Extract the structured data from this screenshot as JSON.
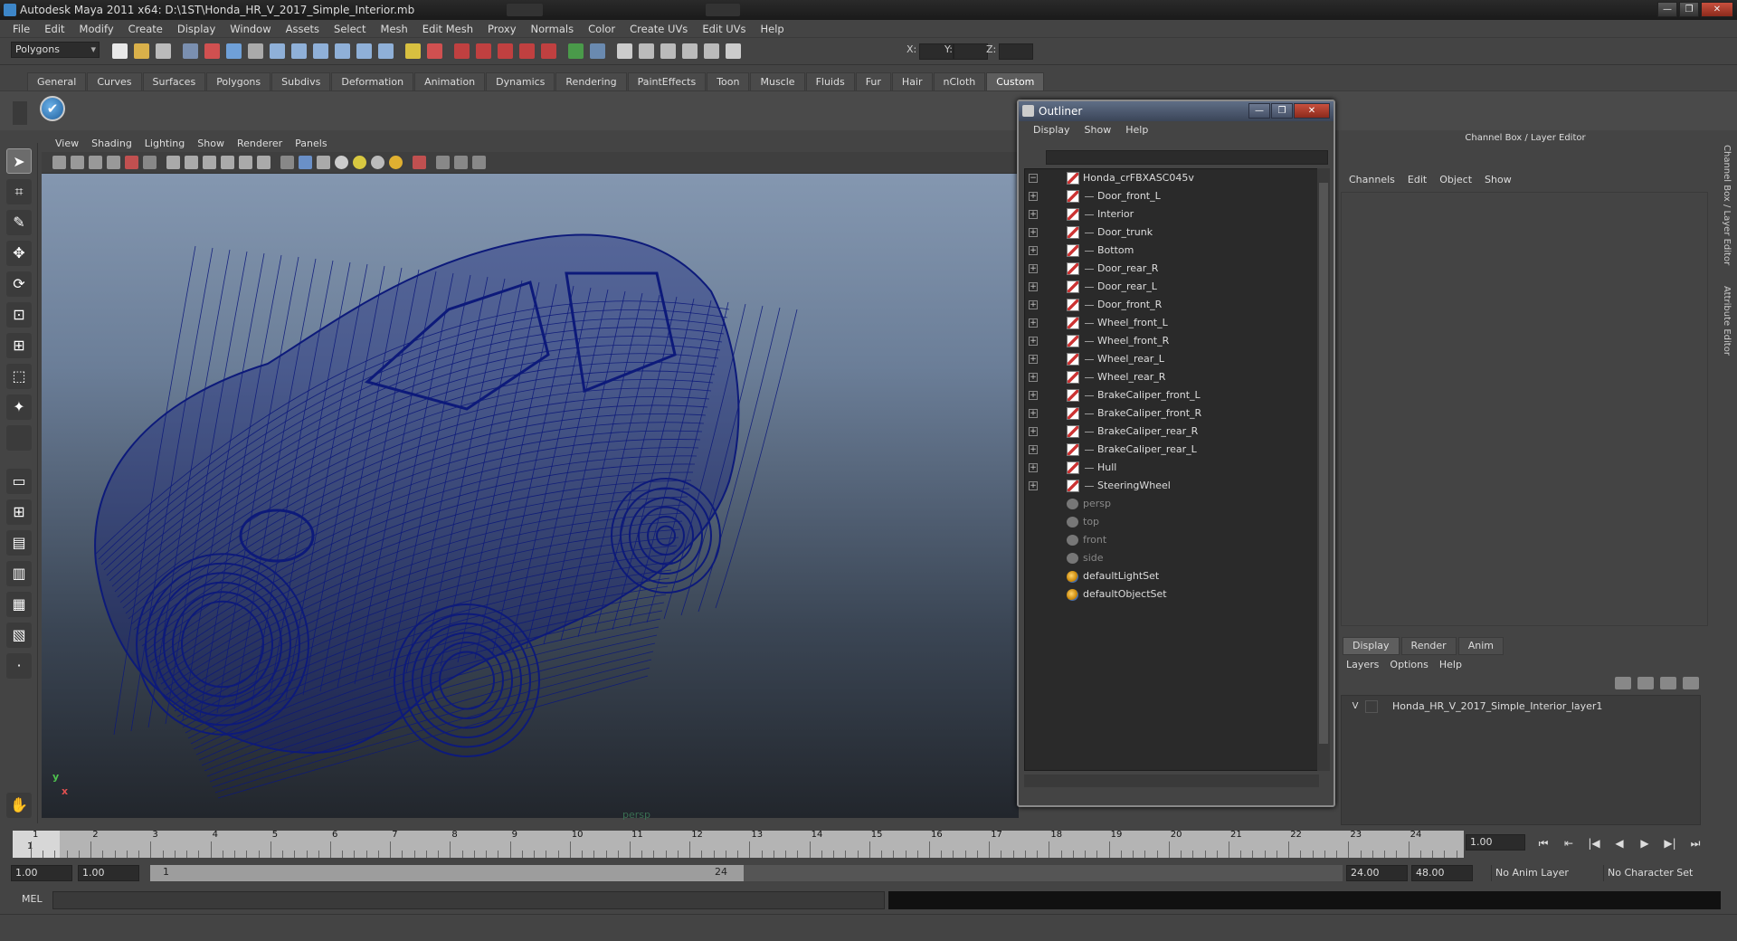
{
  "window": {
    "title": "Autodesk Maya 2011 x64: D:\\1ST\\Honda_HR_V_2017_Simple_Interior.mb"
  },
  "menubar": [
    "File",
    "Edit",
    "Modify",
    "Create",
    "Display",
    "Window",
    "Assets",
    "Select",
    "Mesh",
    "Edit Mesh",
    "Proxy",
    "Normals",
    "Color",
    "Create UVs",
    "Edit UVs",
    "Help"
  ],
  "status": {
    "mode": "Polygons",
    "x_label": "X:",
    "y_label": "Y:",
    "z_label": "Z:"
  },
  "shelf": {
    "tabs": [
      "General",
      "Curves",
      "Surfaces",
      "Polygons",
      "Subdivs",
      "Deformation",
      "Animation",
      "Dynamics",
      "Rendering",
      "PaintEffects",
      "Toon",
      "Muscle",
      "Fluids",
      "Fur",
      "Hair",
      "nCloth",
      "Custom"
    ],
    "active": "Custom"
  },
  "viewport": {
    "menu": [
      "View",
      "Shading",
      "Lighting",
      "Show",
      "Renderer",
      "Panels"
    ],
    "camera": "persp",
    "axis_y": "y",
    "axis_x": "x",
    "wire_color": "#0d1a7a"
  },
  "outliner": {
    "title": "Outliner",
    "menu": [
      "Display",
      "Show",
      "Help"
    ],
    "root": "Honda_crFBXASC045v",
    "children": [
      "Door_front_L",
      "Interior",
      "Door_trunk",
      "Bottom",
      "Door_rear_R",
      "Door_rear_L",
      "Door_front_R",
      "Wheel_front_L",
      "Wheel_front_R",
      "Wheel_rear_L",
      "Wheel_rear_R",
      "BrakeCaliper_front_L",
      "BrakeCaliper_front_R",
      "BrakeCaliper_rear_R",
      "BrakeCaliper_rear_L",
      "Hull",
      "SteeringWheel"
    ],
    "cameras": [
      "persp",
      "top",
      "front",
      "side"
    ],
    "sets": [
      "defaultLightSet",
      "defaultObjectSet"
    ]
  },
  "channel_box": {
    "title": "Channel Box / Layer Editor",
    "menu": [
      "Channels",
      "Edit",
      "Object",
      "Show"
    ],
    "layer_tabs": [
      "Display",
      "Render",
      "Anim"
    ],
    "layer_menu": [
      "Layers",
      "Options",
      "Help"
    ],
    "layer_visible": "V",
    "layer_name": "Honda_HR_V_2017_Simple_Interior_layer1",
    "side_tabs": [
      "Channel Box / Layer Editor",
      "Attribute Editor"
    ]
  },
  "timeline": {
    "ticks": [
      "1",
      "2",
      "3",
      "4",
      "5",
      "6",
      "7",
      "8",
      "9",
      "10",
      "11",
      "12",
      "13",
      "14",
      "15",
      "16",
      "17",
      "18",
      "19",
      "20",
      "21",
      "22",
      "23",
      "24"
    ],
    "current_frame": "1.00",
    "current_mark": "1"
  },
  "range": {
    "start": "1.00",
    "range_start": "1.00",
    "slider_lo": "1",
    "slider_hi": "24",
    "range_end": "24.00",
    "end": "48.00",
    "anim_layer": "No Anim Layer",
    "character_set": "No Character Set"
  },
  "command": {
    "mel_label": "MEL"
  }
}
